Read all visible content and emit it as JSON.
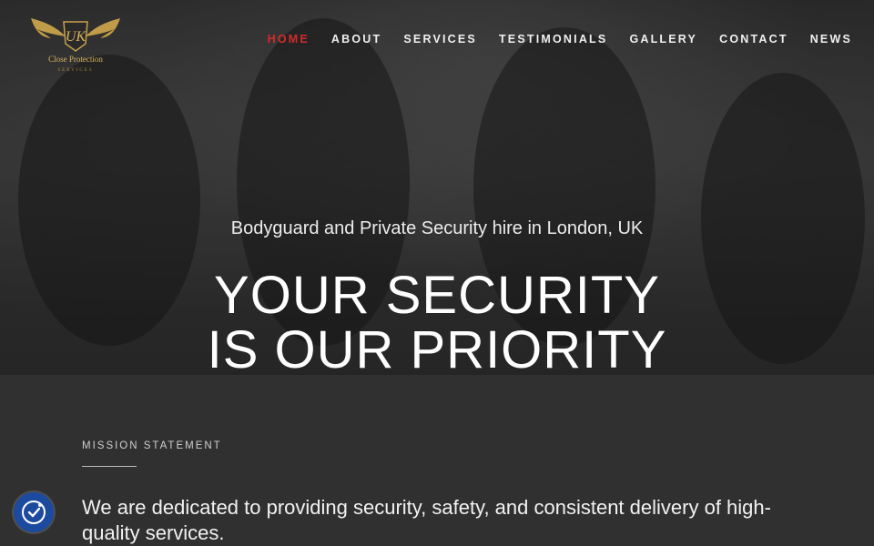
{
  "logo": {
    "monogram": "UK",
    "line1": "Close Protection",
    "line2": "SERVICES",
    "colors": {
      "wing": "#c9a24a",
      "text": "#d9b45c"
    }
  },
  "nav": {
    "items": [
      {
        "label": "HOME",
        "active": true
      },
      {
        "label": "ABOUT",
        "active": false
      },
      {
        "label": "SERVICES",
        "active": false
      },
      {
        "label": "TESTIMONIALS",
        "active": false
      },
      {
        "label": "GALLERY",
        "active": false
      },
      {
        "label": "CONTACT",
        "active": false
      },
      {
        "label": "NEWS",
        "active": false
      }
    ],
    "active_color": "#d42a2a"
  },
  "hero": {
    "tagline": "Bodyguard and Private Security hire in London, UK",
    "headline_line1": "YOUR SECURITY",
    "headline_line2": "IS OUR PRIORITY"
  },
  "mission": {
    "label": "MISSION STATEMENT",
    "text": "We are dedicated to providing security, safety, and consistent delivery of high-quality services."
  },
  "accessibility": {
    "icon": "accessibility-icon",
    "color": "#1c4a9e"
  }
}
